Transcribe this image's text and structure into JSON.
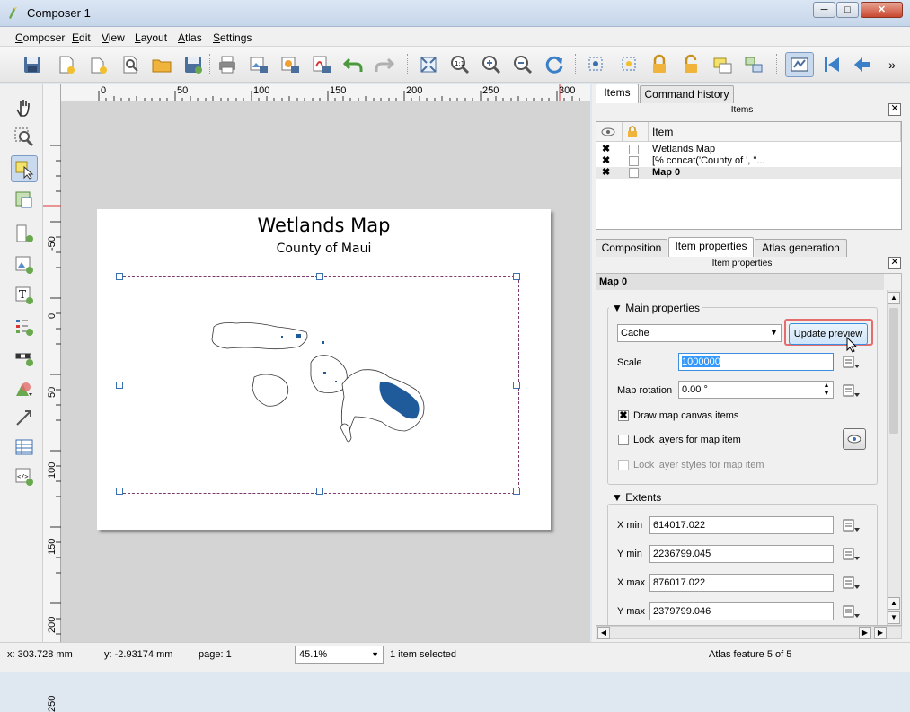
{
  "window": {
    "title": "Composer 1",
    "minimize": "─",
    "maximize": "□",
    "close": "✕"
  },
  "menu": [
    "Composer",
    "Edit",
    "View",
    "Layout",
    "Atlas",
    "Settings"
  ],
  "toolbar": {
    "icons": [
      "save-icon",
      "new-composer-icon",
      "duplicate-composer-icon",
      "composer-manager-icon",
      "open-template-icon",
      "save-template-icon",
      "print-icon",
      "export-image-icon",
      "export-svg-icon",
      "export-pdf-icon",
      "undo-icon",
      "redo-icon",
      "zoom-full-icon",
      "zoom-100-icon",
      "zoom-in-icon",
      "zoom-out-icon",
      "refresh-icon",
      "select-icon",
      "deselect-icon",
      "lock-icon",
      "unlock-icon",
      "group-icon",
      "ungroup-icon",
      "atlas-preview-icon",
      "first-feature-icon",
      "previous-feature-icon"
    ],
    "overflow": "»"
  },
  "ruler": {
    "top": [
      "0",
      "50",
      "100",
      "150",
      "200",
      "250",
      "300"
    ],
    "left": [
      "-50",
      "0",
      "50",
      "100",
      "150",
      "200",
      "250"
    ]
  },
  "layout": {
    "title": "Wetlands Map",
    "subtitle": "County of Maui"
  },
  "panel": {
    "top_tabs": [
      "Items",
      "Command history"
    ],
    "items_dock_title": "Items",
    "items_header": "Item",
    "items": [
      {
        "label": "Wetlands Map",
        "visible": "✖"
      },
      {
        "label": "[% concat('County of ', \"...",
        "visible": "✖"
      },
      {
        "label": "Map 0",
        "visible": "✖"
      }
    ],
    "bottom_tabs": [
      "Composition",
      "Item properties",
      "Atlas generation"
    ],
    "props_dock_title": "Item properties",
    "item_name": "Map 0",
    "main_properties": {
      "title": "Main properties",
      "cache_value": "Cache",
      "update_preview": "Update preview",
      "scale_label": "Scale",
      "scale_value": "1000000",
      "rotation_label": "Map rotation",
      "rotation_value": "0.00 °",
      "draw_canvas_label": "Draw map canvas items",
      "draw_canvas_checked": "✖",
      "lock_layers_label": "Lock layers for map item",
      "lock_styles_label": "Lock layer styles for map item"
    },
    "extents": {
      "title": "Extents",
      "xmin_label": "X min",
      "xmin": "614017.022",
      "ymin_label": "Y min",
      "ymin": "2236799.045",
      "xmax_label": "X max",
      "xmax": "876017.022",
      "ymax_label": "Y max",
      "ymax": "2379799.046"
    }
  },
  "status": {
    "x": "x: 303.728 mm",
    "y": "y: -2.93174 mm",
    "page": "page: 1",
    "zoom": "45.1%",
    "selection": "1 item selected",
    "atlas": "Atlas feature 5 of 5"
  },
  "colors": {
    "accent": "#3399ff",
    "wetland": "#1f5a9a",
    "highlight": "#e46c6c"
  }
}
